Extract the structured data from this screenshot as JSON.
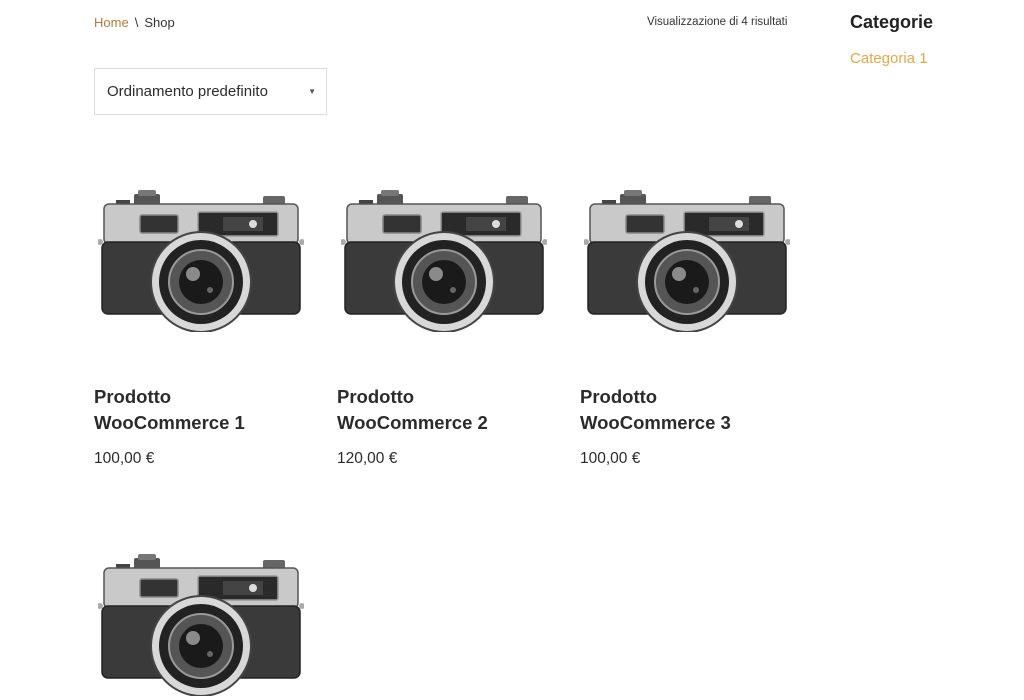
{
  "breadcrumb": {
    "home": "Home",
    "separator": "\\",
    "current": "Shop"
  },
  "result_count": "Visualizzazione di 4 risultati",
  "sort": {
    "selected": "Ordinamento predefinito"
  },
  "sidebar": {
    "title": "Categorie",
    "category": "Categoria 1"
  },
  "products": [
    {
      "title_line1": "Prodotto",
      "title_line2": "WooCommerce 1",
      "price": "100,00 €"
    },
    {
      "title_line1": "Prodotto",
      "title_line2": "WooCommerce 2",
      "price": "120,00 €"
    },
    {
      "title_line1": "Prodotto",
      "title_line2": "WooCommerce 3",
      "price": "100,00 €"
    },
    {
      "title_line1": "",
      "title_line2": "",
      "price": ""
    }
  ],
  "colors": {
    "link": "#b07a3c",
    "accent": "#e0a74f"
  }
}
